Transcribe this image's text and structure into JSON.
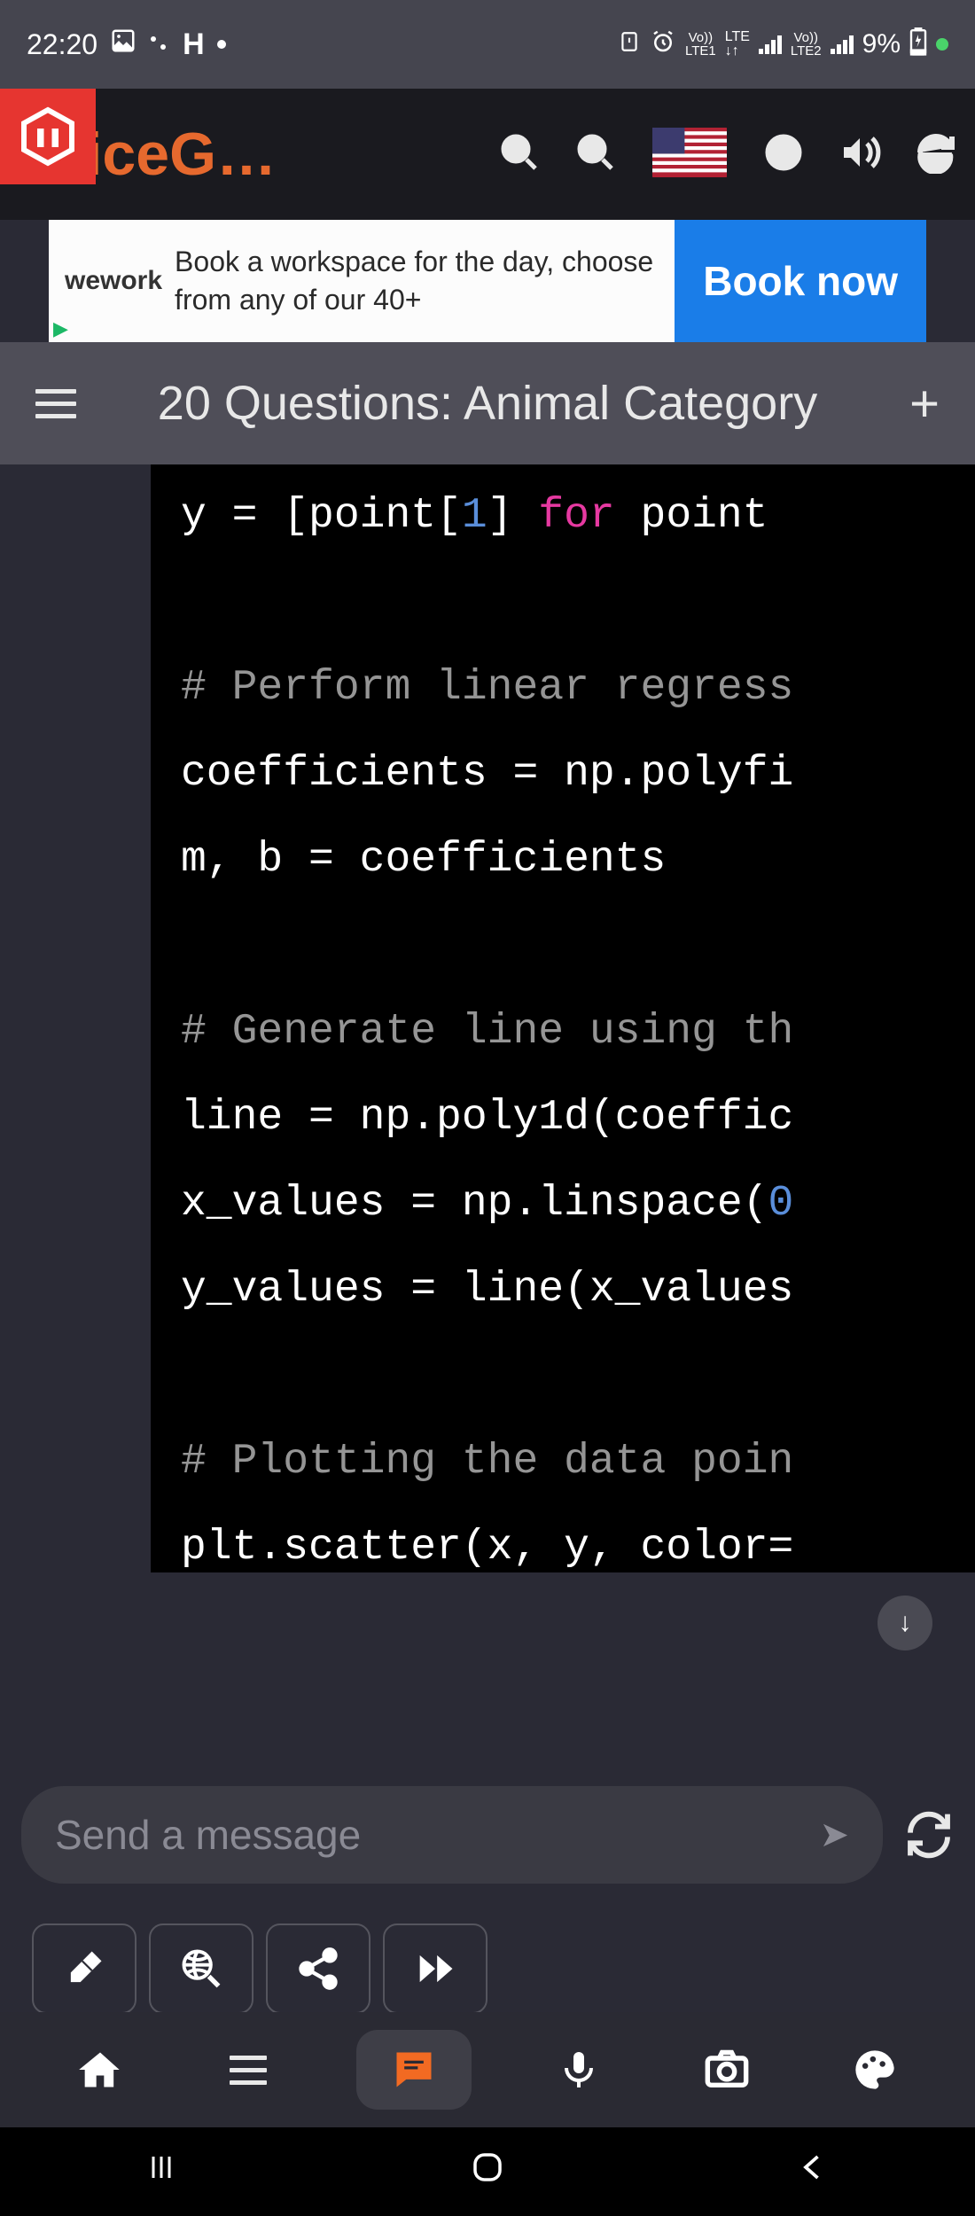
{
  "status_bar": {
    "time": "22:20",
    "lte1": "LTE1",
    "lte2": "LTE2",
    "vo1": "Vo))",
    "vo2": "Vo))",
    "battery": "9%"
  },
  "app": {
    "name": "oiceG…"
  },
  "ad": {
    "logo": "wework",
    "text": "Book a workspace for the day, choose from any of our 40+",
    "button": "Book now"
  },
  "page_title": "20 Questions: Animal Category",
  "code": {
    "l1a": "y = [point[",
    "l1b": "1",
    "l1c": "] ",
    "l1d": "for",
    "l1e": " point ",
    "l2": "",
    "l3": "# Perform linear regress",
    "l4": "coefficients = np.polyfi",
    "l5": "m, b = coefficients",
    "l6": "",
    "l7": "# Generate line using th",
    "l8": "line = np.poly1d(coeffic",
    "l9a": "x_values = np.linspace(",
    "l9b": "0",
    "l10": "y_values = line(x_values",
    "l11": "",
    "l12": "# Plotting the data poin",
    "l13": "plt.scatter(x, y, color="
  },
  "input": {
    "placeholder": "Send a message"
  }
}
